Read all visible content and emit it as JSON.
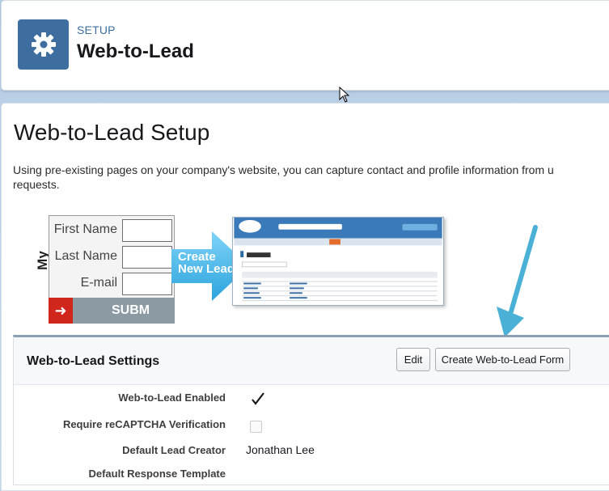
{
  "header": {
    "breadcrumb": "SETUP",
    "title": "Web-to-Lead"
  },
  "main": {
    "title": "Web-to-Lead Setup",
    "intro_line1": "Using pre-existing pages on your company's website, you can capture contact and profile information from u",
    "intro_line2": "requests."
  },
  "illustration": {
    "side_label": "My Website",
    "fields": [
      "First Name",
      "Last Name",
      "E-mail"
    ],
    "submit_label": "SUBM",
    "arrow_line1": "Create",
    "arrow_line2": "New Lead"
  },
  "settings": {
    "title": "Web-to-Lead Settings",
    "edit_label": "Edit",
    "create_form_label": "Create Web-to-Lead Form",
    "rows": [
      {
        "label": "Web-to-Lead Enabled",
        "checked": true
      },
      {
        "label": "Require reCAPTCHA Verification",
        "checked": false
      },
      {
        "label": "Default Lead Creator",
        "value": "Jonathan Lee"
      },
      {
        "label": "Default Response Template",
        "value": ""
      }
    ]
  },
  "colors": {
    "setup_tile": "#3e6e9f",
    "annotation_arrow": "#4ab0d6",
    "submit_red": "#d1261c"
  },
  "icons": {
    "setup_tile": "gear-icon",
    "enabled_check": "checkmark-icon",
    "submit_arrow": "arrow-right-icon"
  }
}
